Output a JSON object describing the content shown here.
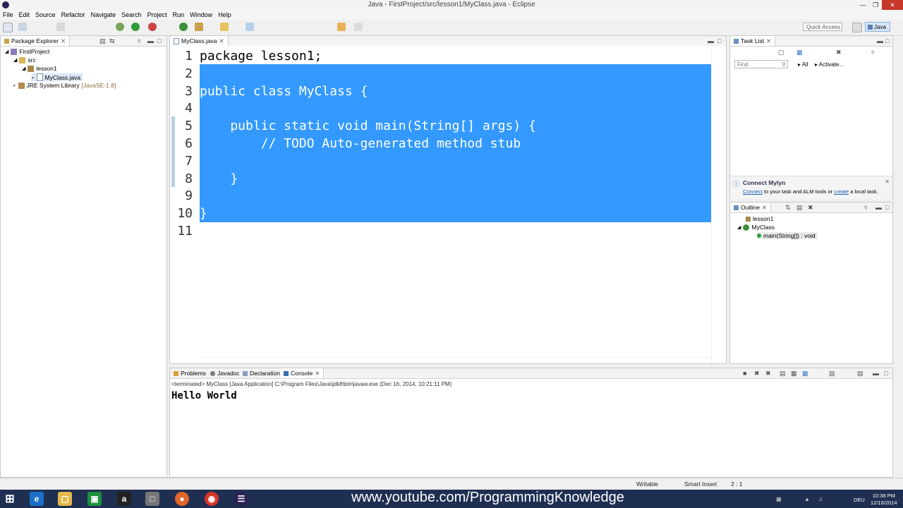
{
  "window": {
    "title": "Java - FirstProject/src/lesson1/MyClass.java - Eclipse"
  },
  "menu": [
    "File",
    "Edit",
    "Source",
    "Refactor",
    "Navigate",
    "Search",
    "Project",
    "Run",
    "Window",
    "Help"
  ],
  "toolbar": {
    "quick_access": "Quick Access",
    "perspective": "Java"
  },
  "package_explorer": {
    "tab": "Package Explorer",
    "tree": {
      "project": "FirstProject",
      "src": "src",
      "package": "lesson1",
      "file": "MyClass.java",
      "jre": "JRE System Library",
      "jre_version": "[JavaSE-1.8]"
    }
  },
  "editor": {
    "tab": "MyClass.java",
    "lines": [
      {
        "n": "1",
        "text": "package lesson1;"
      },
      {
        "n": "2",
        "text": ""
      },
      {
        "n": "3",
        "text": "public class MyClass {"
      },
      {
        "n": "4",
        "text": ""
      },
      {
        "n": "5",
        "text": "    public static void main(String[] args) {"
      },
      {
        "n": "6",
        "text": "        // TODO Auto-generated method stub"
      },
      {
        "n": "7",
        "text": ""
      },
      {
        "n": "8",
        "text": "    }"
      },
      {
        "n": "9",
        "text": ""
      },
      {
        "n": "10",
        "text": "}"
      },
      {
        "n": "11",
        "text": ""
      }
    ]
  },
  "task_list": {
    "tab": "Task List",
    "find_placeholder": "Find",
    "all": "All",
    "activate": "Activate...",
    "mylyn_title": "Connect Mylyn",
    "mylyn_connect": "Connect",
    "mylyn_mid": " to your task and ALM tools or ",
    "mylyn_create": "create",
    "mylyn_end": " a local task."
  },
  "outline": {
    "tab": "Outline",
    "items": [
      "lesson1",
      "MyClass",
      "main(String[]) : void"
    ]
  },
  "console": {
    "tabs": [
      "Problems",
      "Javadoc",
      "Declaration",
      "Console"
    ],
    "terminated": "<terminated> MyClass [Java Application] C:\\Program Files\\Java\\jdk8\\bin\\javaw.exe (Dec 16, 2014, 10:21:11 PM)",
    "output": "Hello World"
  },
  "status": {
    "writable": "Writable",
    "insert": "Smart Insert",
    "position": "2 : 1"
  },
  "taskbar": {
    "watermark": "www.youtube.com/ProgrammingKnowledge",
    "lang": "DEU",
    "time": "10:38 PM",
    "date": "12/16/2014"
  },
  "colors": {
    "selection": "#3399ff",
    "keyword": "#7f0055",
    "taskbar": "#1f2f52"
  }
}
